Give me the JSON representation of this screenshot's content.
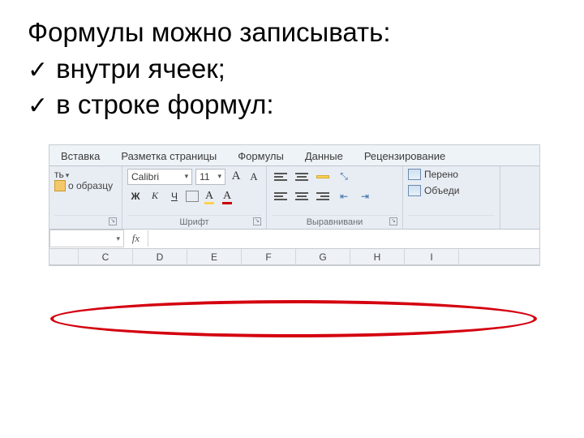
{
  "heading": "Формулы можно записывать:",
  "bullets": [
    "внутри ячеек;",
    "в строке формул:"
  ],
  "checkmark": "✓",
  "tabs": [
    "Вставка",
    "Разметка страницы",
    "Формулы",
    "Данные",
    "Рецензирование"
  ],
  "clipboard": {
    "paste_line": "ть",
    "format_painter": "о образцу"
  },
  "font": {
    "name": "Calibri",
    "size": "11",
    "bold": "Ж",
    "italic": "К",
    "underline": "Ч",
    "grow": "A",
    "shrink": "A",
    "fill": "A",
    "color": "A",
    "group_label": "Шрифт"
  },
  "alignment": {
    "group_label": "Выравнивани"
  },
  "wrap": {
    "wrap_text": "Перено",
    "merge": "Объеди"
  },
  "formula_bar": {
    "name_box": "",
    "fx": "fx",
    "value": ""
  },
  "columns": [
    "",
    "C",
    "D",
    "E",
    "F",
    "G",
    "H",
    "I"
  ]
}
